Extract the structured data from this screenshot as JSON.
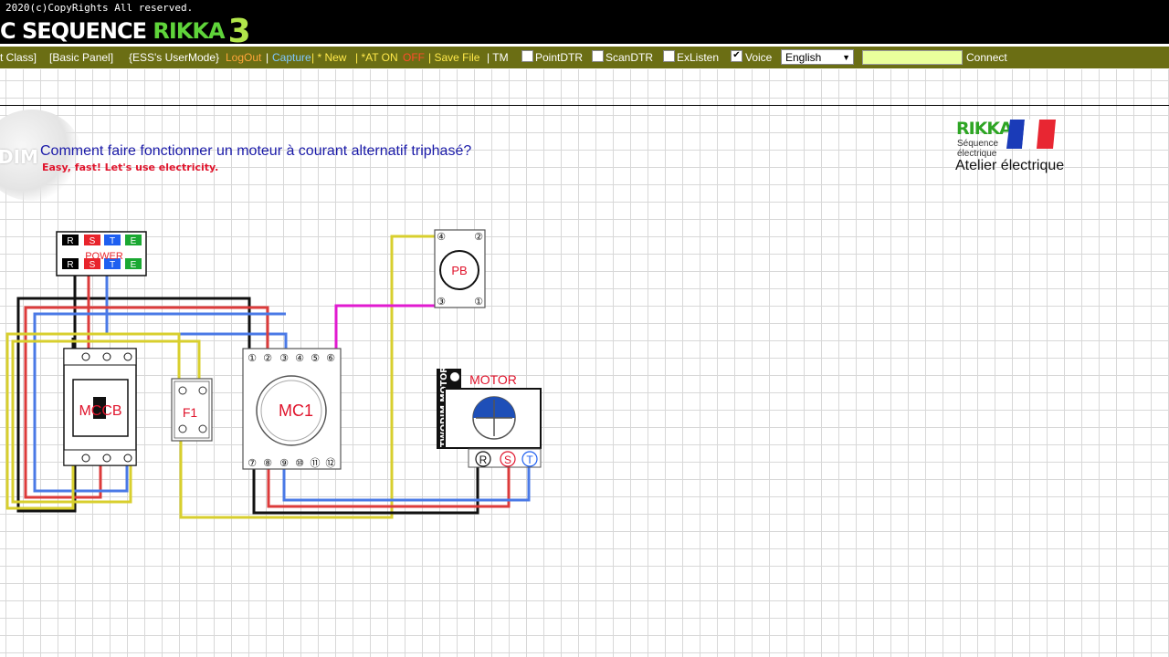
{
  "header": {
    "copyright": "2020(c)CopyRights All reserved.",
    "title_prefix": "C SEQUENCE ",
    "title_rikka": "RIKKA",
    "title_number": "3"
  },
  "toolbar": {
    "class_label": "t Class]",
    "basic_panel": "[Basic Panel]",
    "user_mode": "{ESS's UserMode}",
    "logout": "LogOut",
    "sep1": "|",
    "capture": "Capture",
    "new": "| * New",
    "at_on": "| *AT ON",
    "off": "OFF",
    "save_file": "| Save File",
    "tm": "| TM",
    "pointdtr": "PointDTR",
    "scandtr": "ScanDTR",
    "exlisten": "ExListen",
    "voice": "Voice",
    "voice_checked": "✔",
    "language": "English",
    "connect": "Connect"
  },
  "content": {
    "logo_text": "DIM",
    "question": "Comment faire fonctionner un moteur à courant alternatif triphasé?",
    "subtitle": "Easy, fast! Let's use electricity."
  },
  "brand": {
    "rikka": "RIKKA",
    "seq1": "Séquence",
    "seq2": "électrique",
    "atelier": "Atelier électrique"
  },
  "diagram": {
    "power": {
      "label": "POWER",
      "terminals": [
        "R",
        "S",
        "T",
        "E"
      ],
      "colors": [
        "#000000",
        "#e8242c",
        "#1e5ff0",
        "#1aa832"
      ]
    },
    "mccb": {
      "label": "MCCB"
    },
    "fuse": {
      "label": "F1"
    },
    "mc1": {
      "label": "MC1",
      "top_terminals": [
        "①",
        "②",
        "③",
        "④",
        "⑤",
        "⑥"
      ],
      "bottom_terminals": [
        "⑦",
        "⑧",
        "⑨",
        "⑩",
        "⑪",
        "⑫"
      ]
    },
    "pushbutton": {
      "label": "PB",
      "terminals": [
        "④",
        "②",
        "③",
        "①"
      ]
    },
    "motor": {
      "label": "MOTOR",
      "side_label": "TWODIM MOTOR",
      "terminals": [
        "R",
        "S",
        "T"
      ]
    },
    "wire_colors": {
      "black": "#111111",
      "red": "#dc3b3b",
      "blue": "#4a79e6",
      "yellow": "#d8cf2e",
      "magenta": "#e11ad0"
    }
  }
}
